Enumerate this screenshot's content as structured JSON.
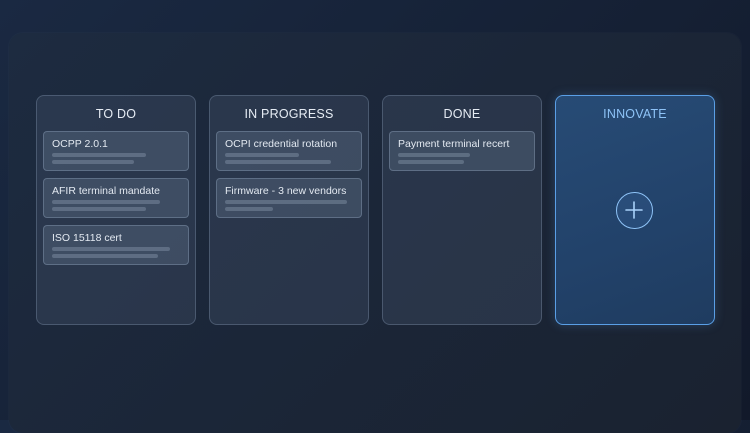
{
  "board": {
    "columns": [
      {
        "title": "TO DO",
        "cards": [
          {
            "title": "OCPP 2.0.1"
          },
          {
            "title": "AFIR terminal mandate"
          },
          {
            "title": "ISO 15118 cert"
          }
        ]
      },
      {
        "title": "IN PROGRESS",
        "cards": [
          {
            "title": "OCPI credential rotation"
          },
          {
            "title": "Firmware - 3 new vendors"
          }
        ]
      },
      {
        "title": "DONE",
        "cards": [
          {
            "title": "Payment terminal recert"
          }
        ]
      },
      {
        "title": "INNOVATE",
        "action_icon": "plus-icon"
      }
    ]
  },
  "colors": {
    "accent": "#5a9fe6",
    "accent_text": "#8ec3f7",
    "background": "#162237"
  }
}
